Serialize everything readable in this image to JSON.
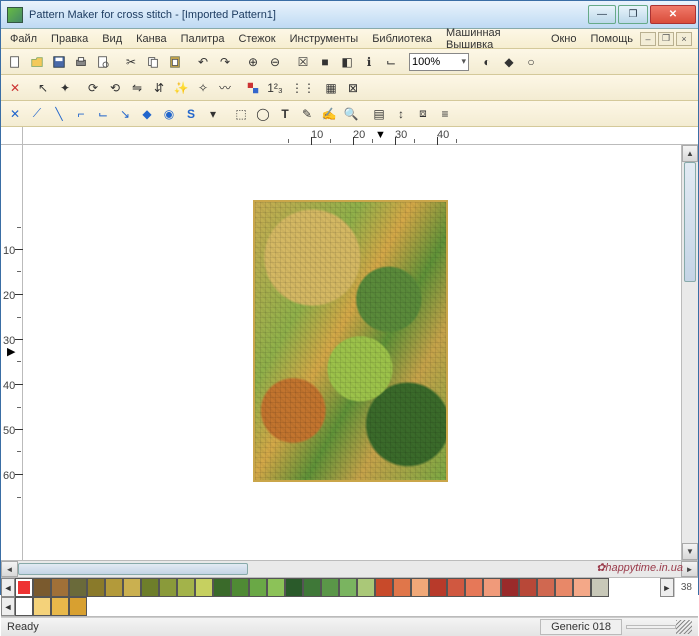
{
  "title": "Pattern Maker for cross stitch - [Imported Pattern1]",
  "menu": [
    "Файл",
    "Правка",
    "Вид",
    "Канва",
    "Палитра",
    "Стежок",
    "Инструменты",
    "Библиотека",
    "Машинная Вышивка",
    "Окно",
    "Помощь"
  ],
  "zoom": "100%",
  "ruler_h": [
    {
      "v": "10",
      "p": 288
    },
    {
      "v": "20",
      "p": 330
    },
    {
      "v": "30",
      "p": 372
    },
    {
      "v": "40",
      "p": 414
    }
  ],
  "ruler_h_minors": [
    265,
    307,
    349,
    391,
    433
  ],
  "marker_h": 352,
  "ruler_v": [
    {
      "v": "10",
      "p": 100
    },
    {
      "v": "20",
      "p": 145
    },
    {
      "v": "30",
      "p": 190
    },
    {
      "v": "40",
      "p": 235
    },
    {
      "v": "50",
      "p": 280
    },
    {
      "v": "60",
      "p": 325
    }
  ],
  "ruler_v_minors": [
    78,
    122,
    168,
    212,
    258,
    302,
    348
  ],
  "marker_v": 200,
  "palette_top": [
    "#e33",
    "#7a5a2e",
    "#a07038",
    "#6a6a3a",
    "#8a7a2a",
    "#b39a3a",
    "#cab050",
    "#6e7e2a",
    "#8a9a3a",
    "#a3b34a",
    "#c6d060",
    "#3a6a2a",
    "#4f8a34",
    "#6aa846",
    "#8cc258",
    "#2a5a2a",
    "#3f7838",
    "#5a9648",
    "#7ab460",
    "#aac878",
    "#c84a2a",
    "#e0764a",
    "#f0a878",
    "#b83a2a",
    "#d05840",
    "#e67858",
    "#f09a7a",
    "#9a2a2a",
    "#b84838",
    "#d06850",
    "#e88868",
    "#f4a888",
    "#c8c8b8"
  ],
  "palette_bot": [
    "#fff",
    "#f4d27a",
    "#e8b84a",
    "#d8a030"
  ],
  "palette_selected": 0,
  "palette_count_top": "38",
  "status_ready": "Ready",
  "status_info": "Generic  018",
  "watermark": "happytime.in.ua",
  "watermark_prefix": "✿"
}
